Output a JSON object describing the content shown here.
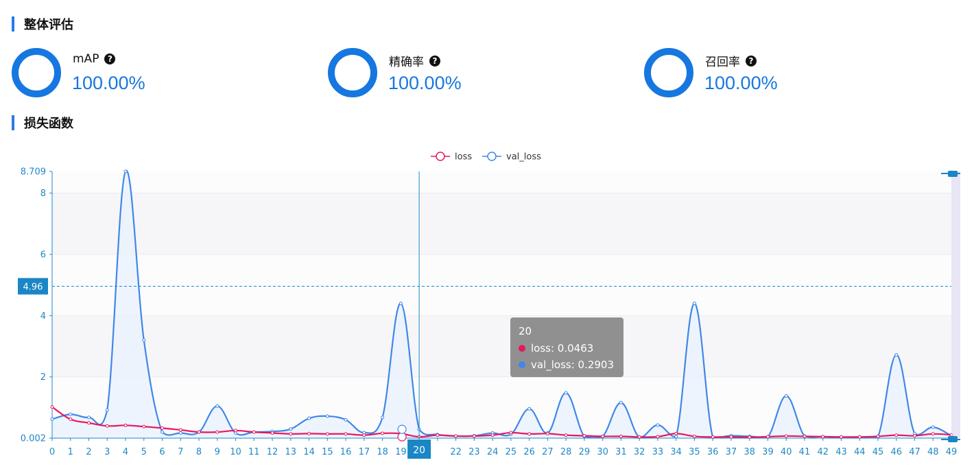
{
  "sections": {
    "overall_title": "整体评估",
    "loss_title": "损失函数"
  },
  "metrics": [
    {
      "label": "mAP",
      "value": "100.00%",
      "help_icon": "question-circle-icon"
    },
    {
      "label": "精确率",
      "value": "100.00%",
      "help_icon": "question-circle-icon"
    },
    {
      "label": "召回率",
      "value": "100.00%",
      "help_icon": "question-circle-icon"
    }
  ],
  "colors": {
    "accent": "#1677e0",
    "loss": "#e8175d",
    "val_loss": "#3f87e8",
    "axis": "#1e88c8",
    "tooltip_bg": "#8c8c8c",
    "dataZoom": "#d9d4ee"
  },
  "chart_data": {
    "type": "line",
    "legend": [
      "loss",
      "val_loss"
    ],
    "legend_position": "top-center",
    "x": [
      0,
      1,
      2,
      3,
      4,
      5,
      6,
      7,
      8,
      9,
      10,
      11,
      12,
      13,
      14,
      15,
      16,
      17,
      18,
      19,
      20,
      21,
      22,
      23,
      24,
      25,
      26,
      27,
      28,
      29,
      30,
      31,
      32,
      33,
      34,
      35,
      36,
      37,
      38,
      39,
      40,
      41,
      42,
      43,
      44,
      45,
      46,
      47,
      48,
      49
    ],
    "x_tick_labels": [
      "0",
      "1",
      "2",
      "3",
      "4",
      "5",
      "6",
      "7",
      "8",
      "9",
      "10",
      "11",
      "12",
      "13",
      "14",
      "15",
      "16",
      "17",
      "18",
      "19",
      "20",
      "22",
      "23",
      "24",
      "25",
      "26",
      "27",
      "28",
      "29",
      "30",
      "31",
      "32",
      "33",
      "34",
      "35",
      "36",
      "37",
      "38",
      "39",
      "40",
      "41",
      "42",
      "43",
      "44",
      "45",
      "46",
      "47",
      "48",
      "49"
    ],
    "series": [
      {
        "name": "loss",
        "values": [
          1.02,
          0.62,
          0.5,
          0.4,
          0.42,
          0.38,
          0.33,
          0.27,
          0.2,
          0.2,
          0.25,
          0.2,
          0.17,
          0.14,
          0.15,
          0.14,
          0.14,
          0.1,
          0.16,
          0.15,
          0.0463,
          0.1,
          0.07,
          0.07,
          0.1,
          0.18,
          0.14,
          0.15,
          0.1,
          0.08,
          0.06,
          0.06,
          0.04,
          0.05,
          0.15,
          0.06,
          0.04,
          0.04,
          0.03,
          0.05,
          0.07,
          0.06,
          0.05,
          0.04,
          0.04,
          0.06,
          0.1,
          0.08,
          0.14,
          0.11
        ]
      },
      {
        "name": "val_loss",
        "values": [
          0.62,
          0.78,
          0.68,
          0.92,
          8.709,
          3.2,
          0.2,
          0.17,
          0.2,
          1.05,
          0.17,
          0.2,
          0.22,
          0.3,
          0.65,
          0.72,
          0.6,
          0.18,
          0.68,
          4.4,
          0.2903,
          0.12,
          0.07,
          0.08,
          0.17,
          0.13,
          0.96,
          0.17,
          1.48,
          0.06,
          0.06,
          1.16,
          0.03,
          0.43,
          0.05,
          4.4,
          0.03,
          0.08,
          0.06,
          0.04,
          1.38,
          0.07,
          0.05,
          0.03,
          0.04,
          0.05,
          2.72,
          0.15,
          0.36,
          0.08
        ]
      }
    ],
    "y_ticks": [
      2,
      4,
      6,
      8
    ],
    "y_min_label": "0.002",
    "y_max_label": "8.709",
    "ylim": [
      0.002,
      8.709
    ],
    "grid": "horizontal bands",
    "crosshair": {
      "x_label": "20",
      "y_label": "4.96",
      "y_value": 4.96
    },
    "tooltip": {
      "title": "20",
      "rows": [
        {
          "series": "loss",
          "text": "loss: 0.0463"
        },
        {
          "series": "val_loss",
          "text": "val_loss: 0.2903"
        }
      ]
    }
  }
}
